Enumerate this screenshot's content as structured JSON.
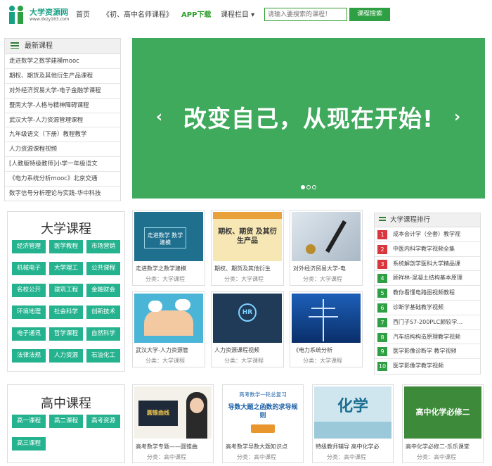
{
  "header": {
    "logo_name": "大学资源网",
    "logo_url": "www.dxzy163.com",
    "nav": [
      "首页",
      "《初、高中名师课程》",
      "APP下载",
      "课程栏目 ▾"
    ],
    "search_placeholder": "请输入要搜索的课程！",
    "search_button": "课程搜索"
  },
  "newest": {
    "title": "最新课程",
    "items": [
      "走进数学之数学建模mooc",
      "期权、期货及其他衍生产品课程",
      "对外经济贸易大学-电子金融学课程",
      "暨南大学-人格与精神障碍课程",
      "武汉大学-人力资源管理课程",
      "九年级语文（下册）教程教学",
      "人力资源课程视频",
      "[人教版特级教师]小学一年级语文",
      "《电力系统分析mooc》北京交通",
      "数字信号分析理论与实践-华中科技"
    ]
  },
  "banner": {
    "text": "改变自己，从现在开始!",
    "prev": "‹",
    "next": "›"
  },
  "university": {
    "title": "大学课程",
    "buttons": [
      "经济管理",
      "医学教程",
      "市场营销",
      "机械电子",
      "大学理工",
      "公共课程",
      "名校公开",
      "建筑工程",
      "金融财会",
      "环境地理",
      "社会科学",
      "创新技术",
      "电子通讯",
      "哲学课程",
      "自然科学",
      "法律法规",
      "人力资源",
      "石油化工"
    ]
  },
  "courses": [
    {
      "title": "走进数学之数学建模",
      "category": "分类：大学课程",
      "thumb_text": "走进数学 数学建模"
    },
    {
      "title": "期权、期货及其他衍生",
      "category": "分类：大学课程",
      "thumb_text": "期权、期货 及其衍生产品"
    },
    {
      "title": "对外经济贸易大学-电",
      "category": "分类：大学课程",
      "thumb_text": ""
    },
    {
      "title": "武汉大学-人力资源管",
      "category": "分类：大学课程",
      "thumb_text": ""
    },
    {
      "title": "人力资源课程视频",
      "category": "分类：大学课程",
      "thumb_text": "HR"
    },
    {
      "title": "《电力系统分析",
      "category": "分类：大学课程",
      "thumb_text": ""
    }
  ],
  "ranking": {
    "title": "大学课程排行",
    "items": [
      "成本会计学（全套）教学视",
      "中医内科学教学视频全集",
      "系统解剖学医科大学精品课",
      "顾祥林-混凝土结构基本原理",
      "教你看懂电路图视频教程",
      "诊断学基础教学视频",
      "西门子S7-200PLC颇较学…",
      "汽车结构构造原理教学视频",
      "医学影像诊断学 教学视频",
      "医学影像学教学视频"
    ]
  },
  "highschool": {
    "title": "高中课程",
    "buttons": [
      "高一课程",
      "高二课程",
      "高考资源",
      "高三课程"
    ]
  },
  "hs_courses": [
    {
      "title": "高考数学专题——圆锥曲",
      "category": "分类：高中课程",
      "thumb_text": "圆锥曲线"
    },
    {
      "title": "高考数学导数大题知识点",
      "category": "分类：高中课程",
      "thumb_text": "导数大题之函数的求导规则"
    },
    {
      "title": "特级教师辅导 高中化学必",
      "category": "分类：高中课程",
      "thumb_text": "化学"
    },
    {
      "title": "高中化学必修二-乐乐课堂",
      "category": "分类：高中课程",
      "thumb_text": "高中化学必修二"
    }
  ],
  "hs_course_extra": {
    "header_text": "高考数学一轮总复习"
  },
  "colors": {
    "brand_green": "#2ea043",
    "button_teal": "#25b38f",
    "rank_red": "#d9363e",
    "banner": "#3fa95c"
  }
}
